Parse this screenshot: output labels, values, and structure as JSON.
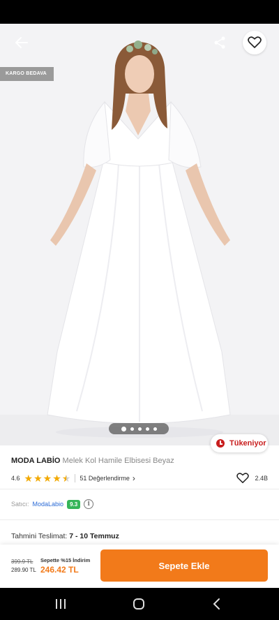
{
  "badge": {
    "cargo": "KARGO BEDAVA"
  },
  "gallery": {
    "dot_count": 5,
    "active_index": 0
  },
  "stock": {
    "label": "Tükeniyor"
  },
  "product": {
    "brand": "MODA LABİO",
    "name": "Melek Kol Hamile Elbisesi Beyaz",
    "rating": "4.6",
    "rating_value": 4.6,
    "reviews": "51 Değerlendirme",
    "likes": "2.4B"
  },
  "seller": {
    "label": "Satıcı:",
    "name": "ModaLabio",
    "score": "9.3"
  },
  "delivery": {
    "label": "Tahmini Teslimat:",
    "value": "7 - 10 Temmuz"
  },
  "pricing": {
    "old_price": "399.9 TL",
    "current_price": "289.90 TL",
    "promo_label": "Sepette %15 İndirim",
    "promo_price": "246.42 TL"
  },
  "actions": {
    "add_to_cart": "Sepete Ekle"
  },
  "icons": {
    "back": "arrow-left-icon",
    "share": "share-icon",
    "favorite": "heart-icon",
    "info": "info-icon",
    "nav_recents": "recents-icon",
    "nav_home": "home-icon",
    "nav_back": "back-icon"
  },
  "colors": {
    "accent": "#f27a1a",
    "stock_alert": "#c81e1e",
    "seller_score": "#35b559",
    "seller_link": "#2b6bd6",
    "stars": "#f2a900"
  }
}
